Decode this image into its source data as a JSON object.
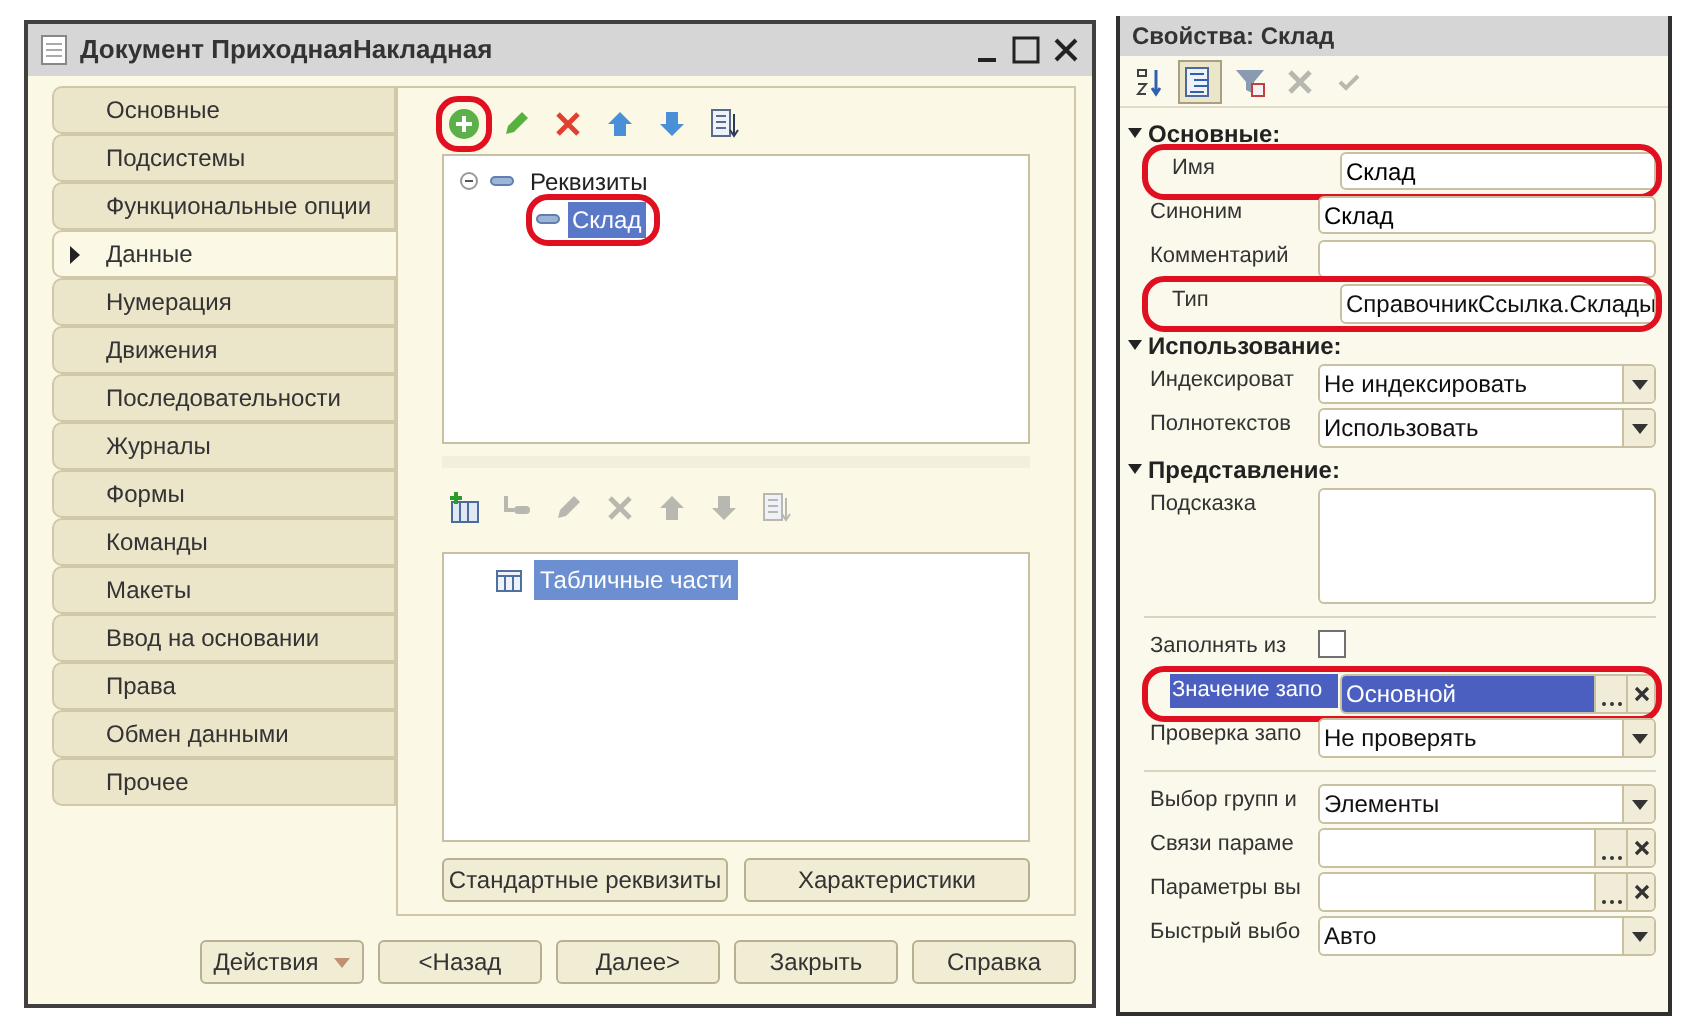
{
  "window": {
    "title": "Документ ПриходнаяНакладная"
  },
  "tabs": [
    {
      "label": "Основные",
      "selected": false
    },
    {
      "label": "Подсистемы",
      "selected": false
    },
    {
      "label": "Функциональные опции",
      "selected": false
    },
    {
      "label": "Данные",
      "selected": true
    },
    {
      "label": "Нумерация",
      "selected": false
    },
    {
      "label": "Движения",
      "selected": false
    },
    {
      "label": "Последовательности",
      "selected": false
    },
    {
      "label": "Журналы",
      "selected": false
    },
    {
      "label": "Формы",
      "selected": false
    },
    {
      "label": "Команды",
      "selected": false
    },
    {
      "label": "Макеты",
      "selected": false
    },
    {
      "label": "Ввод на основании",
      "selected": false
    },
    {
      "label": "Права",
      "selected": false
    },
    {
      "label": "Обмен данными",
      "selected": false
    },
    {
      "label": "Прочее",
      "selected": false
    }
  ],
  "attributes_toolbar": [
    {
      "kind": "add",
      "disabled": false,
      "highlighted": true
    },
    {
      "kind": "edit",
      "disabled": false,
      "highlighted": false
    },
    {
      "kind": "delete",
      "disabled": false,
      "highlighted": false
    },
    {
      "kind": "up",
      "disabled": false,
      "highlighted": false
    },
    {
      "kind": "down",
      "disabled": false,
      "highlighted": false
    },
    {
      "kind": "sort",
      "disabled": false,
      "highlighted": false
    }
  ],
  "attributes_tree": [
    {
      "label": "Реквизиты",
      "expanded": true,
      "selected": false,
      "highlighted": false,
      "children": [
        {
          "label": "Склад",
          "selected": true,
          "highlighted": true
        }
      ]
    }
  ],
  "tables_toolbar": [
    {
      "kind": "add-table",
      "disabled": false,
      "highlighted": false
    },
    {
      "kind": "add-child",
      "disabled": true,
      "highlighted": false
    },
    {
      "kind": "edit",
      "disabled": true,
      "highlighted": false
    },
    {
      "kind": "delete",
      "disabled": true,
      "highlighted": false
    },
    {
      "kind": "up",
      "disabled": true,
      "highlighted": false
    },
    {
      "kind": "down",
      "disabled": true,
      "highlighted": false
    },
    {
      "kind": "sort",
      "disabled": true,
      "highlighted": false
    }
  ],
  "tables_tree": [
    {
      "label": "Табличные части",
      "selected": true
    }
  ],
  "panel_buttons": [
    "Стандартные реквизиты",
    "Характеристики"
  ],
  "footer_buttons": [
    {
      "label": "Действия",
      "dropdown": true
    },
    {
      "label": "<Назад",
      "dropdown": false
    },
    {
      "label": "Далее>",
      "dropdown": false
    },
    {
      "label": "Закрыть",
      "dropdown": false
    },
    {
      "label": "Справка",
      "dropdown": false
    }
  ],
  "properties": {
    "title": "Свойства: Склад",
    "toolbar": [
      {
        "kind": "sort-az",
        "pressed": false,
        "disabled": false
      },
      {
        "kind": "categories",
        "pressed": true,
        "disabled": false
      },
      {
        "kind": "filter",
        "pressed": false,
        "disabled": false
      },
      {
        "kind": "clear",
        "pressed": false,
        "disabled": true
      },
      {
        "kind": "accept",
        "pressed": false,
        "disabled": true
      }
    ],
    "rows": [
      {
        "kind": "section",
        "label": "Основные:"
      },
      {
        "kind": "text",
        "label": "Имя",
        "value": "Склад",
        "highlighted": true,
        "selected": false
      },
      {
        "kind": "text",
        "label": "Синоним",
        "value": "Склад",
        "highlighted": false,
        "selected": false
      },
      {
        "kind": "text",
        "label": "Комментарий",
        "highlighted": false,
        "selected": false
      },
      {
        "kind": "type",
        "label": "Тип",
        "value": "СправочникСсылка.Склады",
        "highlighted": true,
        "selected": false
      },
      {
        "kind": "section",
        "label": "Использование:"
      },
      {
        "kind": "select",
        "label": "Индексироват",
        "value": "Не индексировать",
        "highlighted": false,
        "selected": false
      },
      {
        "kind": "select",
        "label": "Полнотекстов",
        "value": "Использовать",
        "highlighted": false,
        "selected": false
      },
      {
        "kind": "section",
        "label": "Представление:"
      },
      {
        "kind": "memo",
        "label": "Подсказка",
        "highlighted": false,
        "selected": false
      },
      {
        "kind": "divider"
      },
      {
        "kind": "checkbox",
        "label": "Заполнять из",
        "checked": false,
        "highlighted": false,
        "selected": false
      },
      {
        "kind": "ref",
        "label": "Значение запо",
        "value": "Основной",
        "highlighted": true,
        "selected": true
      },
      {
        "kind": "select",
        "label": "Проверка запо",
        "value": "Не проверять",
        "highlighted": false,
        "selected": false
      },
      {
        "kind": "divider"
      },
      {
        "kind": "select",
        "label": "Выбор групп и",
        "value": "Элементы",
        "highlighted": false,
        "selected": false
      },
      {
        "kind": "ref",
        "label": "Связи параме",
        "highlighted": false,
        "selected": false
      },
      {
        "kind": "ref",
        "label": "Параметры вы",
        "highlighted": false,
        "selected": false
      },
      {
        "kind": "select",
        "label": "Быстрый выбо",
        "value": "Авто",
        "highlighted": false,
        "selected": false
      }
    ]
  }
}
